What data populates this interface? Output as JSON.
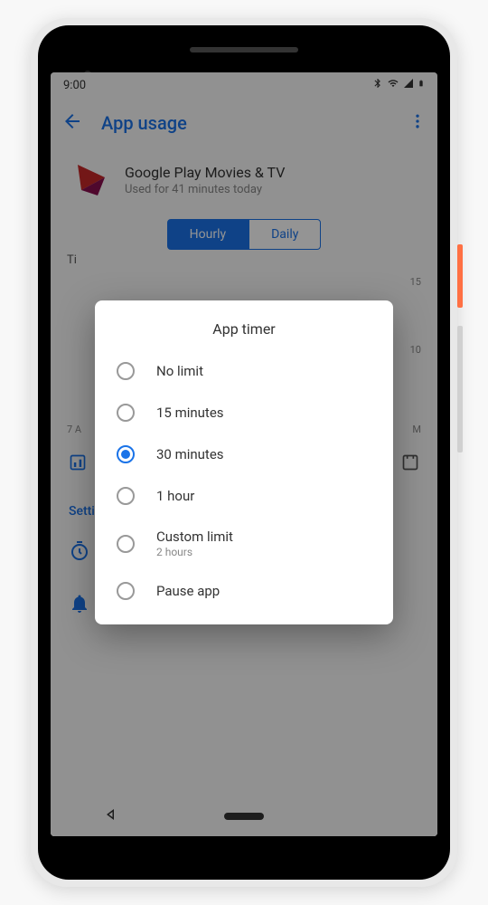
{
  "status": {
    "time": "9:00"
  },
  "header": {
    "title": "App usage"
  },
  "app": {
    "name": "Google Play Movies & TV",
    "usage": "Used for 41 minutes today"
  },
  "tabs": {
    "hourly": "Hourly",
    "daily": "Daily"
  },
  "chart": {
    "section_label": "Ti",
    "y_top": "15",
    "y_mid": "10",
    "x_left": "7 A",
    "x_right": "M"
  },
  "settings": {
    "header": "Settings",
    "timer": {
      "title": "App timer",
      "value": "30 minutes"
    },
    "notifications": {
      "title": "Notifications"
    }
  },
  "dialog": {
    "title": "App timer",
    "options": [
      {
        "label": "No limit",
        "sub": "",
        "selected": false
      },
      {
        "label": "15 minutes",
        "sub": "",
        "selected": false
      },
      {
        "label": "30 minutes",
        "sub": "",
        "selected": true
      },
      {
        "label": "1 hour",
        "sub": "",
        "selected": false
      },
      {
        "label": "Custom limit",
        "sub": "2 hours",
        "selected": false
      },
      {
        "label": "Pause app",
        "sub": "",
        "selected": false
      }
    ]
  }
}
